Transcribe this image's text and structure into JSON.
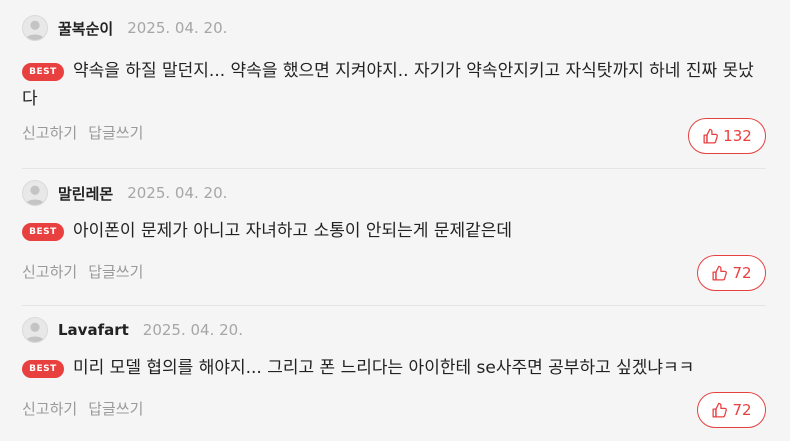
{
  "best_badge": "BEST",
  "actions": {
    "report": "신고하기",
    "reply": "답글쓰기"
  },
  "comments": [
    {
      "nickname": "꿀복순이",
      "date": "2025. 04. 20.",
      "text": "약속을 하질 말던지... 약속을 했으면 지켜야지.. 자기가 약속안지키고 자식탓까지 하네 진짜 못났다",
      "likes": "132"
    },
    {
      "nickname": "말린레몬",
      "date": "2025. 04. 20.",
      "text": "아이폰이 문제가 아니고 자녀하고 소통이 안되는게 문제같은데",
      "likes": "72"
    },
    {
      "nickname": "Lavafart",
      "date": "2025. 04. 20.",
      "text": "미리 모델 협의를 해야지... 그리고 폰 느리다는 아이한테 se사주면 공부하고 싶겠냐ㅋㅋ",
      "likes": "72"
    }
  ],
  "colors": {
    "accent": "#e8403f",
    "background": "#f5f5f5",
    "date": "#a6a6a6",
    "action": "#9a9a9a"
  },
  "icons": {
    "avatar": "default-user-avatar",
    "like": "thumbs-up-outline"
  }
}
